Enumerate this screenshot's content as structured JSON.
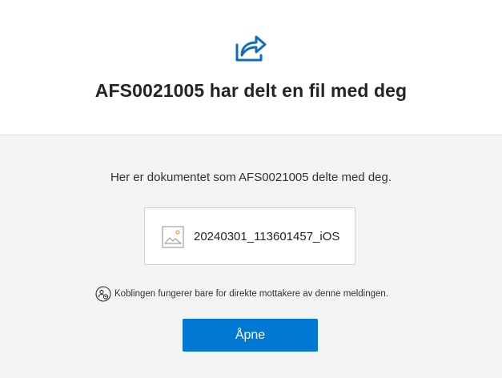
{
  "header": {
    "icon": "share-arrow-icon",
    "title": "AFS0021005 har delt en fil med deg"
  },
  "main": {
    "message": "Her er dokumentet som AFS0021005 delte med deg.",
    "file": {
      "icon": "image-file-icon",
      "name": "20240301_113601457_iOS"
    },
    "notice": {
      "icon": "people-link-icon",
      "text": "Koblingen fungerer bare for direkte mottakere av denne meldingen."
    },
    "open_button_label": "Åpne"
  },
  "colors": {
    "accent": "#0078d4",
    "background": "#f4f4f4",
    "divider": "#e1dfdd"
  }
}
